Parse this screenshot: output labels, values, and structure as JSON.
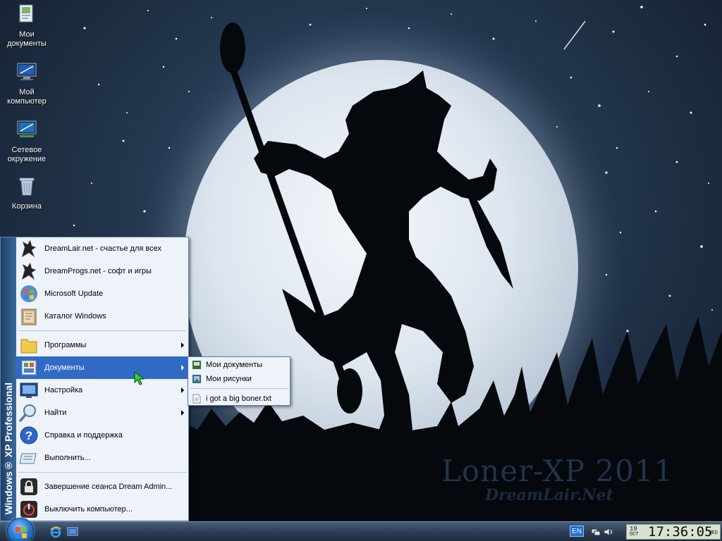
{
  "desktop": {
    "icons": [
      {
        "label": "Мои документы",
        "icon": "my-documents-icon"
      },
      {
        "label": "Мой компьютер",
        "icon": "my-computer-icon"
      },
      {
        "label": "Сетевое окружение",
        "icon": "network-places-icon"
      },
      {
        "label": "Корзина",
        "icon": "recycle-bin-icon"
      }
    ],
    "wallpaper": {
      "line1": "Loner-XP 2011",
      "line2": "DreamLair.Net"
    }
  },
  "start_menu": {
    "banner": "Windows® XP Professional",
    "pinned": [
      {
        "label": "DreamLair.net - счастье для всех",
        "icon": "wolf-logo-icon"
      },
      {
        "label": "DreamProgs.net - софт и игры",
        "icon": "wolf-logo-icon"
      },
      {
        "label": "Microsoft Update",
        "icon": "windows-update-icon"
      },
      {
        "label": "Каталог Windows",
        "icon": "windows-catalog-icon"
      }
    ],
    "items": [
      {
        "label": "Программы",
        "icon": "programs-folder-icon",
        "submenu": true
      },
      {
        "label": "Документы",
        "icon": "documents-icon",
        "submenu": true,
        "selected": true
      },
      {
        "label": "Настройка",
        "icon": "settings-icon",
        "submenu": true
      },
      {
        "label": "Найти",
        "icon": "search-icon",
        "submenu": true
      },
      {
        "label": "Справка и поддержка",
        "icon": "help-icon"
      },
      {
        "label": "Выполнить...",
        "icon": "run-icon"
      }
    ],
    "bottom": [
      {
        "label": "Завершение сеанса Dream Admin...",
        "icon": "lock-icon"
      },
      {
        "label": "Выключить компьютер...",
        "icon": "power-icon"
      }
    ]
  },
  "documents_submenu": {
    "items": [
      {
        "label": "Мои документы",
        "icon": "my-documents-icon"
      },
      {
        "label": "Мои рисунки",
        "icon": "my-pictures-icon"
      }
    ],
    "recent": [
      {
        "label": "i got a big boner.txt",
        "icon": "text-file-icon"
      }
    ]
  },
  "taskbar": {
    "quick_launch": [
      "internet-explorer-icon",
      "show-desktop-icon"
    ],
    "tray": {
      "language": "EN",
      "icons": [
        "network-icon",
        "volume-icon"
      ],
      "clock": {
        "day": "19",
        "month": "OCT",
        "time": "17:36:05",
        "weekday": "WED"
      }
    }
  },
  "colors": {
    "selection": "#316ac5",
    "menu_bg": "#eef3fa",
    "banner": "#1f3f66"
  }
}
